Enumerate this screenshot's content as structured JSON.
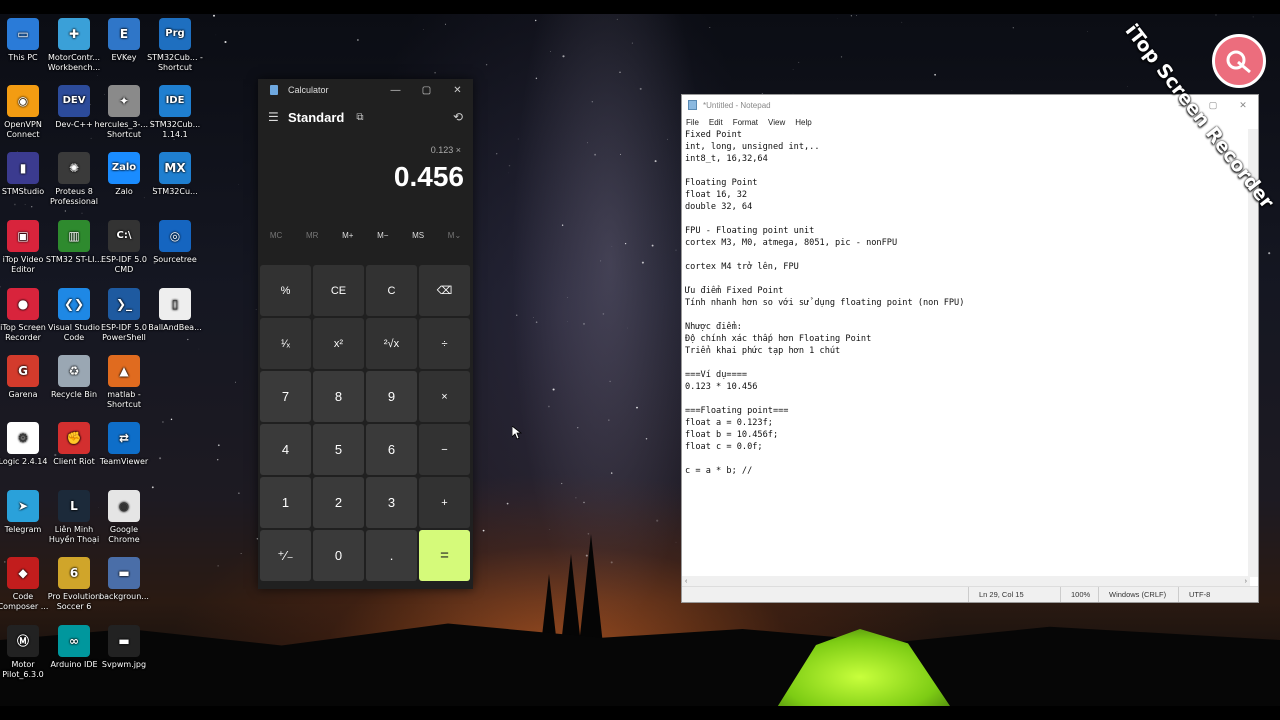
{
  "desktop_icons": [
    {
      "label": "This PC",
      "color": "#2a7bd8",
      "glyph": "▭"
    },
    {
      "label": "MotorContr... Workbench...",
      "color": "#3aa0d8",
      "glyph": "✚"
    },
    {
      "label": "EVKey",
      "color": "#2f76c8",
      "glyph": "E"
    },
    {
      "label": "STM32Cub... - Shortcut",
      "color": "#1e6fc0",
      "glyph": "Prg"
    },
    {
      "label": "OpenVPN Connect",
      "color": "#f39c12",
      "glyph": "◉"
    },
    {
      "label": "Dev-C++",
      "color": "#2c4b9a",
      "glyph": "DEV"
    },
    {
      "label": "hercules_3-... - Shortcut",
      "color": "#8a8a8a",
      "glyph": "✦"
    },
    {
      "label": "STM32Cub... 1.14.1",
      "color": "#1f7fd0",
      "glyph": "IDE"
    },
    {
      "label": "STMStudio",
      "color": "#3b3b8f",
      "glyph": "▮"
    },
    {
      "label": "Proteus 8 Professional",
      "color": "#3a3a3a",
      "glyph": "✺"
    },
    {
      "label": "Zalo",
      "color": "#1a8cff",
      "glyph": "Zalo"
    },
    {
      "label": "STM32Cu...",
      "color": "#1f7fd0",
      "glyph": "MX"
    },
    {
      "label": "iTop Video Editor",
      "color": "#d8243c",
      "glyph": "▣"
    },
    {
      "label": "STM32 ST-LI...",
      "color": "#2e8a2e",
      "glyph": "▥"
    },
    {
      "label": "ESP-IDF 5.0 CMD",
      "color": "#333333",
      "glyph": "C:\\"
    },
    {
      "label": "Sourcetree",
      "color": "#1565c0",
      "glyph": "◎"
    },
    {
      "label": "iTop Screen Recorder",
      "color": "#d8243c",
      "glyph": "●"
    },
    {
      "label": "Visual Studio Code",
      "color": "#1e88e5",
      "glyph": "❮❯"
    },
    {
      "label": "ESP-IDF 5.0 PowerShell",
      "color": "#1e5aa0",
      "glyph": "❯_"
    },
    {
      "label": "BallAndBea...",
      "color": "#eeeeee",
      "glyph": "▯"
    },
    {
      "label": "Garena",
      "color": "#d33b2c",
      "glyph": "G"
    },
    {
      "label": "Recycle Bin",
      "color": "#9aa7b3",
      "glyph": "♻"
    },
    {
      "label": "matlab - Shortcut",
      "color": "#e06b1f",
      "glyph": "▲"
    },
    {
      "label": "",
      "color": "",
      "glyph": ""
    },
    {
      "label": "Logic 2.4.14",
      "color": "#ffffff",
      "glyph": "⚙"
    },
    {
      "label": "Client Riot",
      "color": "#d32f2f",
      "glyph": "✊"
    },
    {
      "label": "TeamViewer",
      "color": "#0e6ec9",
      "glyph": "⇄"
    },
    {
      "label": "",
      "color": "",
      "glyph": ""
    },
    {
      "label": "Telegram",
      "color": "#2aa1da",
      "glyph": "➤"
    },
    {
      "label": "Liên Minh Huyền Thoại",
      "color": "#1c2a3a",
      "glyph": "L"
    },
    {
      "label": "Google Chrome",
      "color": "#e5e5e5",
      "glyph": "◉"
    },
    {
      "label": "",
      "color": "",
      "glyph": ""
    },
    {
      "label": "Code Composer ...",
      "color": "#c21d1d",
      "glyph": "◆"
    },
    {
      "label": "Pro Evolution Soccer 6",
      "color": "#d0a52a",
      "glyph": "6"
    },
    {
      "label": "backgroun...",
      "color": "#4a6ea8",
      "glyph": "▬"
    },
    {
      "label": "",
      "color": "",
      "glyph": ""
    },
    {
      "label": "Motor Pilot_6.3.0",
      "color": "#222222",
      "glyph": "Ⓜ"
    },
    {
      "label": "Arduino IDE",
      "color": "#00979d",
      "glyph": "∞"
    },
    {
      "label": "Svpwm.jpg",
      "color": "#222222",
      "glyph": "▬"
    }
  ],
  "calculator": {
    "title": "Calculator",
    "mode": "Standard",
    "expression": "0.123 ×",
    "result": "0.456",
    "memory": [
      "MC",
      "MR",
      "M+",
      "M−",
      "MS",
      "M⌄"
    ],
    "keys": [
      "%",
      "CE",
      "C",
      "⌫",
      "¹⁄ₓ",
      "x²",
      "²√x",
      "÷",
      "7",
      "8",
      "9",
      "×",
      "4",
      "5",
      "6",
      "−",
      "1",
      "2",
      "3",
      "+",
      "⁺∕₋",
      "0",
      ".",
      "="
    ]
  },
  "notepad": {
    "title": "*Untitled - Notepad",
    "menu": [
      "File",
      "Edit",
      "Format",
      "View",
      "Help"
    ],
    "lines": [
      "Fixed Point",
      "int, long, unsigned int,..",
      "int8_t, 16,32,64",
      "",
      "Floating Point",
      "float 16, 32",
      "double 32, 64",
      "",
      "FPU - Floating point unit",
      "cortex M3, M0, atmega, 8051, pic - nonFPU",
      "",
      "cortex M4 trở lên, FPU",
      "",
      "Ưu điểm Fixed Point",
      "Tính nhanh hơn so với sử dụng floating point (non FPU)",
      "",
      "Nhược điểm:",
      "Độ chính xác thấp hơn Floating Point",
      "Triển khai phức tạp hơn 1 chút",
      "",
      "===Ví dụ====",
      "0.123 * 10.456",
      "",
      "===Floating point===",
      "float a = 0.123f;",
      "float b = 10.456f;",
      "float c = 0.0f;",
      "",
      "c = a * b; //"
    ],
    "status": {
      "position": "Ln 29, Col 15",
      "zoom": "100%",
      "line_ending": "Windows (CRLF)",
      "encoding": "UTF-8"
    }
  },
  "watermark": {
    "text": "iTop Screen Recorder"
  }
}
